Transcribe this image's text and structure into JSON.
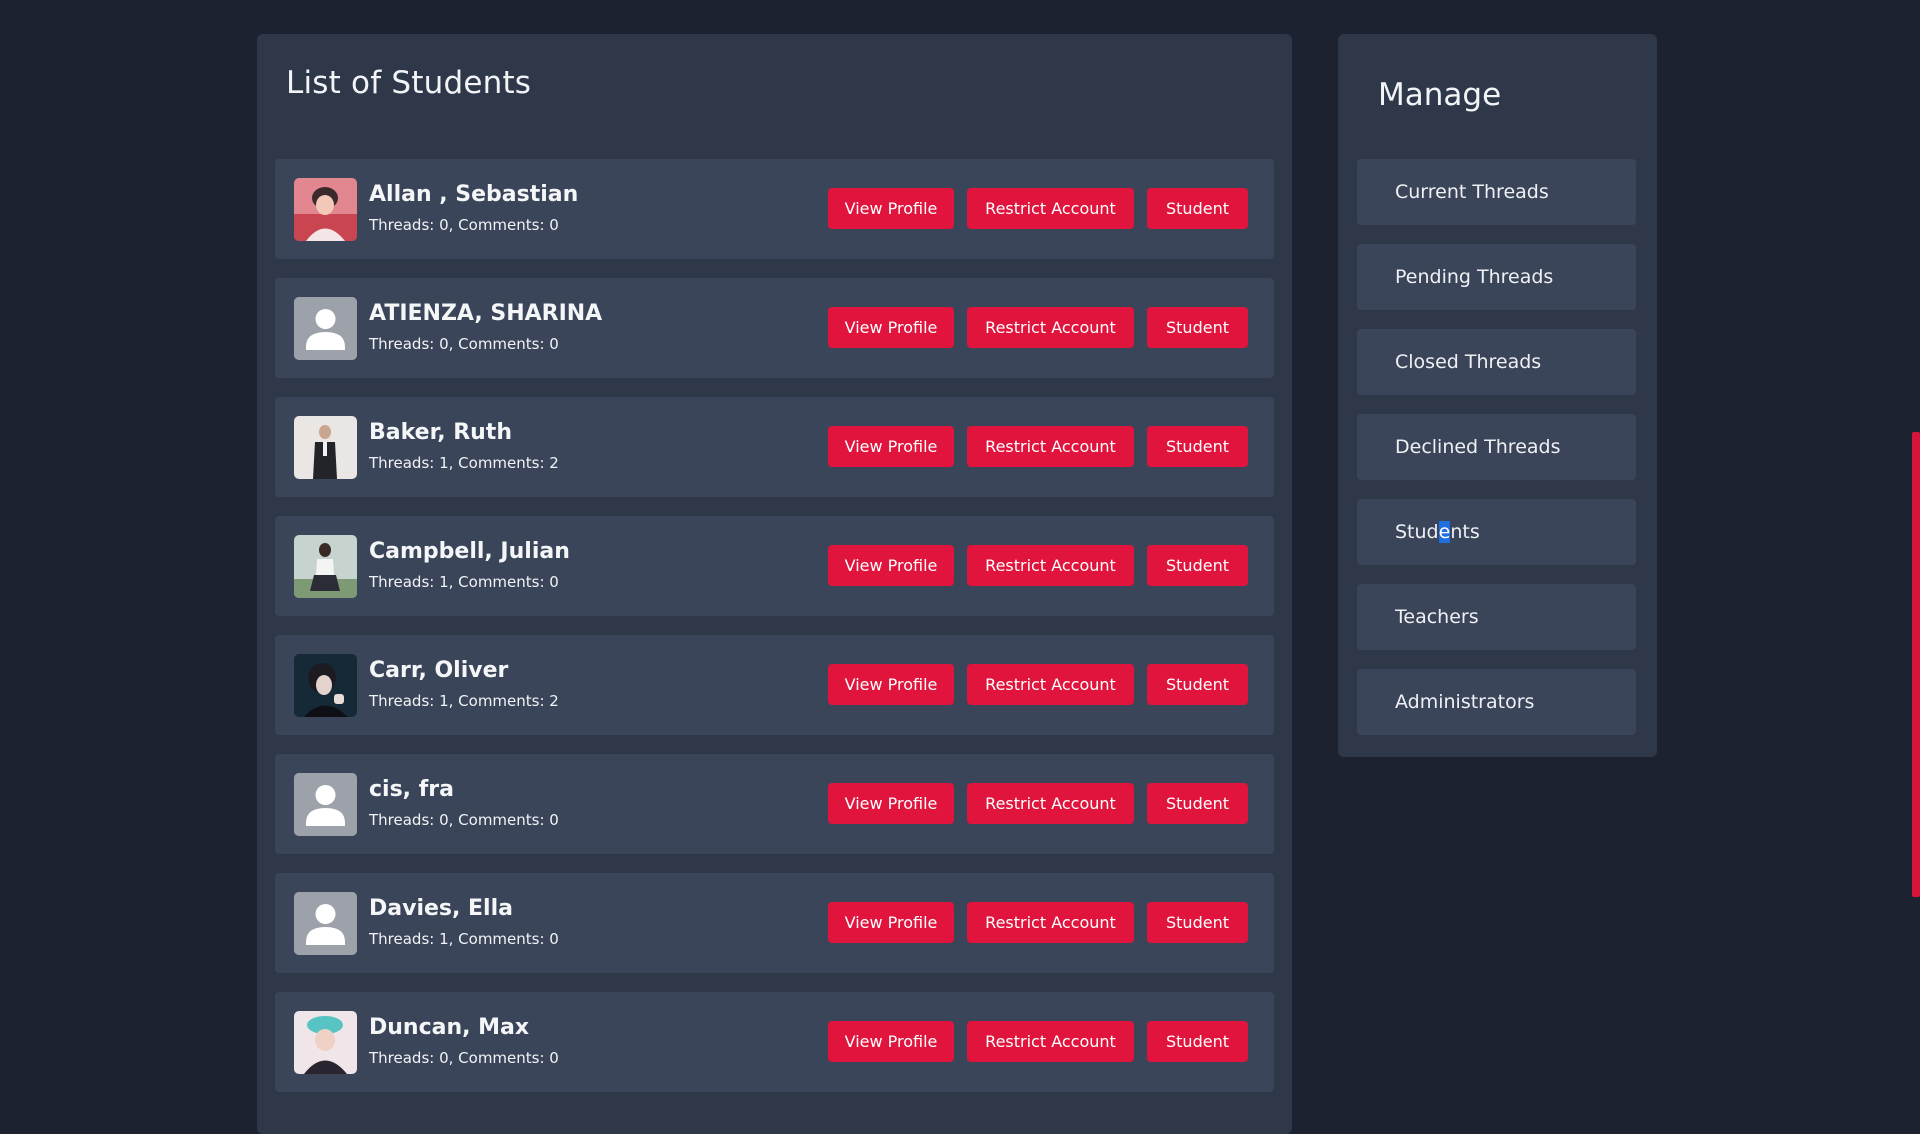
{
  "main": {
    "title": "List of Students",
    "students": [
      {
        "name": "Allan , Sebastian",
        "stats": "Threads: 0, Comments: 0",
        "avatar": "photo-avatar-pink"
      },
      {
        "name": "ATIENZA, SHARINA",
        "stats": "Threads: 0, Comments: 0",
        "avatar": "default-user-icon"
      },
      {
        "name": "Baker, Ruth",
        "stats": "Threads: 1, Comments: 2",
        "avatar": "photo-avatar-suit"
      },
      {
        "name": "Campbell, Julian",
        "stats": "Threads: 1, Comments: 0",
        "avatar": "photo-avatar-outdoor"
      },
      {
        "name": "Carr, Oliver",
        "stats": "Threads: 1, Comments: 2",
        "avatar": "photo-avatar-dark"
      },
      {
        "name": "cis, fra",
        "stats": "Threads: 0, Comments: 0",
        "avatar": "default-user-icon"
      },
      {
        "name": "Davies, Ella",
        "stats": "Threads: 1, Comments: 0",
        "avatar": "default-user-icon"
      },
      {
        "name": "Duncan, Max",
        "stats": "Threads: 0, Comments: 0",
        "avatar": "photo-avatar-teal"
      }
    ],
    "buttons": {
      "view_profile": "View Profile",
      "restrict_account": "Restrict Account",
      "role": "Student"
    }
  },
  "sidebar": {
    "title": "Manage",
    "items": [
      {
        "label": "Current Threads"
      },
      {
        "label": "Pending Threads"
      },
      {
        "label": "Closed Threads"
      },
      {
        "label": "Declined Threads"
      },
      {
        "label_before": "Stud",
        "label_selected": "e",
        "label_after": "nts"
      },
      {
        "label": "Teachers"
      },
      {
        "label": "Administrators"
      }
    ]
  },
  "colors": {
    "background": "#1c2230",
    "panel": "#2f3849",
    "card": "#3b4559",
    "accent": "#e0143c",
    "selection": "#1e6fe0"
  }
}
